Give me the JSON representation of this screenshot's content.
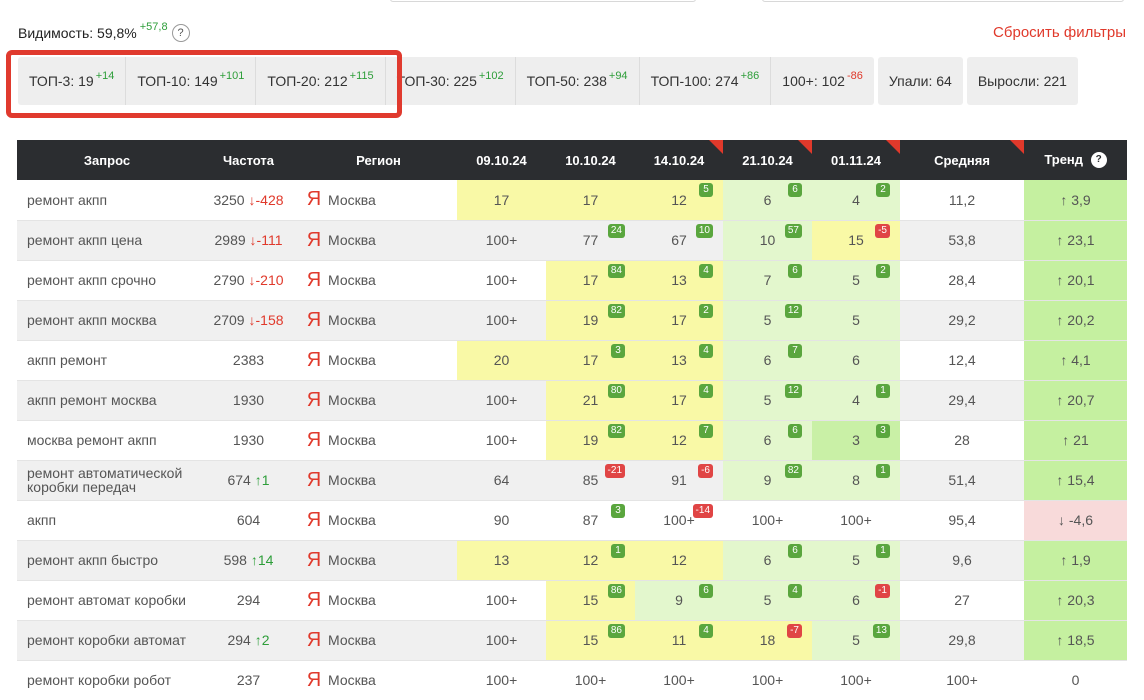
{
  "visibility": {
    "label": "Видимость: 59,8%",
    "delta": "+57,8",
    "help": "?"
  },
  "reset_label": "Сбросить фильтры",
  "tops": [
    {
      "label": "ТОП-3: 19",
      "delta": "+14",
      "dir": "up"
    },
    {
      "label": "ТОП-10: 149",
      "delta": "+101",
      "dir": "up"
    },
    {
      "label": "ТОП-20: 212",
      "delta": "+115",
      "dir": "up"
    },
    {
      "label": "ТОП-30: 225",
      "delta": "+102",
      "dir": "up"
    },
    {
      "label": "ТОП-50: 238",
      "delta": "+94",
      "dir": "up"
    },
    {
      "label": "ТОП-100: 274",
      "delta": "+86",
      "dir": "up"
    },
    {
      "label": "100+: 102",
      "delta": "-86",
      "dir": "down"
    }
  ],
  "fell_label": "Упали: 64",
  "grew_label": "Выросли: 221",
  "columns": [
    "Запрос",
    "Частота",
    "Регион",
    "09.10.24",
    "10.10.24",
    "14.10.24",
    "21.10.24",
    "01.11.24",
    "Средняя",
    "Тренд"
  ],
  "search_engine_icon": "yandex-icon",
  "colors": {
    "yellow": "#f9f9a6",
    "light_green": "#e3f7cd",
    "green": "#c9f0a6",
    "badge_up": "#5aa63e",
    "badge_down": "#e04545",
    "accent_red": "#e0392b"
  },
  "rows": [
    {
      "query": "ремонт акпп",
      "freq": "3250",
      "fdelta": "↓-428",
      "fdir": "down",
      "yandex": "Я",
      "region": "Москва",
      "cells": [
        {
          "v": "17",
          "bg": "c-yellow"
        },
        {
          "v": "17",
          "bg": "c-yellow"
        },
        {
          "v": "12",
          "bg": "c-yellow",
          "b": "5",
          "bd": "up"
        },
        {
          "v": "6",
          "bg": "c-lgreen",
          "b": "6",
          "bd": "up"
        },
        {
          "v": "4",
          "bg": "c-lgreen",
          "b": "2",
          "bd": "up"
        }
      ],
      "avg": "11,2",
      "trend": "↑ 3,9",
      "tdir": "up"
    },
    {
      "query": "ремонт акпп цена",
      "freq": "2989",
      "fdelta": "↓-111",
      "fdir": "down",
      "yandex": "Я",
      "region": "Москва",
      "cells": [
        {
          "v": "100+",
          "bg": ""
        },
        {
          "v": "77",
          "bg": "",
          "b": "24",
          "bd": "up"
        },
        {
          "v": "67",
          "bg": "",
          "b": "10",
          "bd": "up"
        },
        {
          "v": "10",
          "bg": "c-lgreen",
          "b": "57",
          "bd": "up"
        },
        {
          "v": "15",
          "bg": "c-yellow",
          "b": "-5",
          "bd": "down"
        }
      ],
      "avg": "53,8",
      "trend": "↑ 23,1",
      "tdir": "up"
    },
    {
      "query": "ремонт акпп срочно",
      "freq": "2790",
      "fdelta": "↓-210",
      "fdir": "down",
      "yandex": "Я",
      "region": "Москва",
      "cells": [
        {
          "v": "100+",
          "bg": ""
        },
        {
          "v": "17",
          "bg": "c-yellow",
          "b": "84",
          "bd": "up"
        },
        {
          "v": "13",
          "bg": "c-yellow",
          "b": "4",
          "bd": "up"
        },
        {
          "v": "7",
          "bg": "c-lgreen",
          "b": "6",
          "bd": "up"
        },
        {
          "v": "5",
          "bg": "c-lgreen",
          "b": "2",
          "bd": "up"
        }
      ],
      "avg": "28,4",
      "trend": "↑ 20,1",
      "tdir": "up"
    },
    {
      "query": "ремонт акпп москва",
      "freq": "2709",
      "fdelta": "↓-158",
      "fdir": "down",
      "yandex": "Я",
      "region": "Москва",
      "cells": [
        {
          "v": "100+",
          "bg": ""
        },
        {
          "v": "19",
          "bg": "c-yellow",
          "b": "82",
          "bd": "up"
        },
        {
          "v": "17",
          "bg": "c-yellow",
          "b": "2",
          "bd": "up"
        },
        {
          "v": "5",
          "bg": "c-lgreen",
          "b": "12",
          "bd": "up"
        },
        {
          "v": "5",
          "bg": "c-lgreen"
        }
      ],
      "avg": "29,2",
      "trend": "↑ 20,2",
      "tdir": "up"
    },
    {
      "query": "акпп ремонт",
      "freq": "2383",
      "fdelta": "",
      "fdir": "",
      "yandex": "Я",
      "region": "Москва",
      "cells": [
        {
          "v": "20",
          "bg": "c-yellow"
        },
        {
          "v": "17",
          "bg": "c-yellow",
          "b": "3",
          "bd": "up"
        },
        {
          "v": "13",
          "bg": "c-yellow",
          "b": "4",
          "bd": "up"
        },
        {
          "v": "6",
          "bg": "c-lgreen",
          "b": "7",
          "bd": "up"
        },
        {
          "v": "6",
          "bg": "c-lgreen"
        }
      ],
      "avg": "12,4",
      "trend": "↑ 4,1",
      "tdir": "up"
    },
    {
      "query": "акпп ремонт москва",
      "freq": "1930",
      "fdelta": "",
      "fdir": "",
      "yandex": "Я",
      "region": "Москва",
      "cells": [
        {
          "v": "100+",
          "bg": ""
        },
        {
          "v": "21",
          "bg": "c-yellow",
          "b": "80",
          "bd": "up"
        },
        {
          "v": "17",
          "bg": "c-yellow",
          "b": "4",
          "bd": "up"
        },
        {
          "v": "5",
          "bg": "c-lgreen",
          "b": "12",
          "bd": "up"
        },
        {
          "v": "4",
          "bg": "c-lgreen",
          "b": "1",
          "bd": "up"
        }
      ],
      "avg": "29,4",
      "trend": "↑ 20,7",
      "tdir": "up"
    },
    {
      "query": "москва ремонт акпп",
      "freq": "1930",
      "fdelta": "",
      "fdir": "",
      "yandex": "Я",
      "region": "Москва",
      "cells": [
        {
          "v": "100+",
          "bg": ""
        },
        {
          "v": "19",
          "bg": "c-yellow",
          "b": "82",
          "bd": "up"
        },
        {
          "v": "12",
          "bg": "c-yellow",
          "b": "7",
          "bd": "up"
        },
        {
          "v": "6",
          "bg": "c-lgreen",
          "b": "6",
          "bd": "up"
        },
        {
          "v": "3",
          "bg": "c-green",
          "b": "3",
          "bd": "up"
        }
      ],
      "avg": "28",
      "trend": "↑ 21",
      "tdir": "up"
    },
    {
      "query": "ремонт автоматической коробки передач",
      "freq": "674",
      "fdelta": "↑1",
      "fdir": "up",
      "yandex": "Я",
      "region": "Москва",
      "cells": [
        {
          "v": "64",
          "bg": ""
        },
        {
          "v": "85",
          "bg": "",
          "b": "-21",
          "bd": "down"
        },
        {
          "v": "91",
          "bg": "",
          "b": "-6",
          "bd": "down"
        },
        {
          "v": "9",
          "bg": "c-lgreen",
          "b": "82",
          "bd": "up"
        },
        {
          "v": "8",
          "bg": "c-lgreen",
          "b": "1",
          "bd": "up"
        }
      ],
      "avg": "51,4",
      "trend": "↑ 15,4",
      "tdir": "up"
    },
    {
      "query": "акпп",
      "freq": "604",
      "fdelta": "",
      "fdir": "",
      "yandex": "Я",
      "region": "Москва",
      "cells": [
        {
          "v": "90",
          "bg": ""
        },
        {
          "v": "87",
          "bg": "",
          "b": "3",
          "bd": "up"
        },
        {
          "v": "100+",
          "bg": "",
          "b": "-14",
          "bd": "down"
        },
        {
          "v": "100+",
          "bg": ""
        },
        {
          "v": "100+",
          "bg": ""
        }
      ],
      "avg": "95,4",
      "trend": "↓ -4,6",
      "tdir": "down"
    },
    {
      "query": "ремонт акпп быстро",
      "freq": "598",
      "fdelta": "↑14",
      "fdir": "up",
      "yandex": "Я",
      "region": "Москва",
      "cells": [
        {
          "v": "13",
          "bg": "c-yellow"
        },
        {
          "v": "12",
          "bg": "c-yellow",
          "b": "1",
          "bd": "up"
        },
        {
          "v": "12",
          "bg": "c-yellow"
        },
        {
          "v": "6",
          "bg": "c-lgreen",
          "b": "6",
          "bd": "up"
        },
        {
          "v": "5",
          "bg": "c-lgreen",
          "b": "1",
          "bd": "up"
        }
      ],
      "avg": "9,6",
      "trend": "↑ 1,9",
      "tdir": "up"
    },
    {
      "query": "ремонт автомат коробки",
      "freq": "294",
      "fdelta": "",
      "fdir": "",
      "yandex": "Я",
      "region": "Москва",
      "cells": [
        {
          "v": "100+",
          "bg": ""
        },
        {
          "v": "15",
          "bg": "c-yellow",
          "b": "86",
          "bd": "up"
        },
        {
          "v": "9",
          "bg": "c-lgreen",
          "b": "6",
          "bd": "up"
        },
        {
          "v": "5",
          "bg": "c-lgreen",
          "b": "4",
          "bd": "up"
        },
        {
          "v": "6",
          "bg": "c-lgreen",
          "b": "-1",
          "bd": "down"
        }
      ],
      "avg": "27",
      "trend": "↑ 20,3",
      "tdir": "up"
    },
    {
      "query": "ремонт коробки автомат",
      "freq": "294",
      "fdelta": "↑2",
      "fdir": "up",
      "yandex": "Я",
      "region": "Москва",
      "cells": [
        {
          "v": "100+",
          "bg": ""
        },
        {
          "v": "15",
          "bg": "c-yellow",
          "b": "86",
          "bd": "up"
        },
        {
          "v": "11",
          "bg": "c-yellow",
          "b": "4",
          "bd": "up"
        },
        {
          "v": "18",
          "bg": "c-yellow",
          "b": "-7",
          "bd": "down"
        },
        {
          "v": "5",
          "bg": "c-lgreen",
          "b": "13",
          "bd": "up"
        }
      ],
      "avg": "29,8",
      "trend": "↑ 18,5",
      "tdir": "up"
    },
    {
      "query": "ремонт коробки робот",
      "freq": "237",
      "fdelta": "",
      "fdir": "",
      "yandex": "Я",
      "region": "Москва",
      "cells": [
        {
          "v": "100+",
          "bg": ""
        },
        {
          "v": "100+",
          "bg": ""
        },
        {
          "v": "100+",
          "bg": ""
        },
        {
          "v": "100+",
          "bg": ""
        },
        {
          "v": "100+",
          "bg": ""
        }
      ],
      "avg": "100+",
      "trend": "0",
      "tdir": "zero"
    }
  ]
}
